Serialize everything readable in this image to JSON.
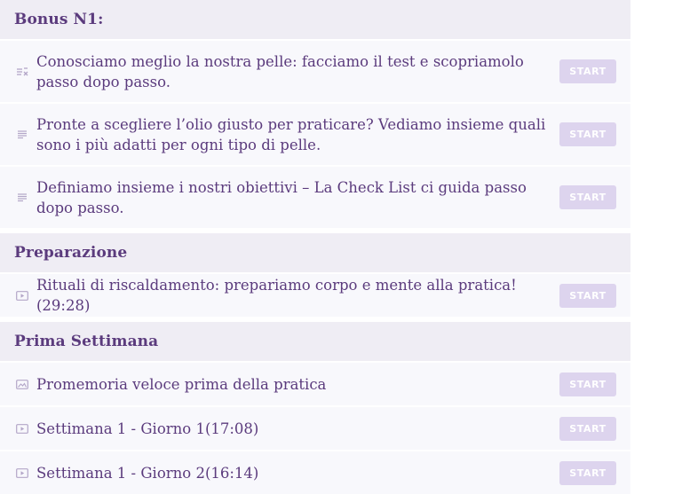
{
  "sections": [
    {
      "title": "Bonus N1:",
      "lessons": [
        {
          "icon": "quiz-icon",
          "title": "Conosciamo meglio la nostra pelle: facciamo il test e scopriamolo passo dopo passo.",
          "action": "START"
        },
        {
          "icon": "text-icon",
          "title": "Pronte a scegliere l’olio giusto per praticare? Vediamo insieme quali sono i più adatti per ogni tipo di pelle.",
          "action": "START"
        },
        {
          "icon": "text-icon",
          "title": "Definiamo insieme i nostri obiettivi – La Check List ci guida passo dopo passo.",
          "action": "START"
        }
      ]
    },
    {
      "title": "Preparazione",
      "lessons": [
        {
          "icon": "video-icon",
          "title": "Rituali di riscaldamento: prepariamo corpo e mente alla pratica!(29:28)",
          "action": "START"
        }
      ]
    },
    {
      "title": "Prima Settimana",
      "lessons": [
        {
          "icon": "image-icon",
          "title": "Promemoria veloce prima della pratica",
          "action": "START"
        },
        {
          "icon": "video-icon",
          "title": "Settimana 1 - Giorno 1(17:08)",
          "action": "START"
        },
        {
          "icon": "video-icon",
          "title": "Settimana 1 - Giorno 2(16:14)",
          "action": "START"
        }
      ]
    }
  ],
  "colors": {
    "header_bg": "#efedf4",
    "row_bg": "#f8f8fc",
    "text": "#5b3b7d",
    "button_bg": "#ddd4ee",
    "icon": "#b3a6c8"
  }
}
